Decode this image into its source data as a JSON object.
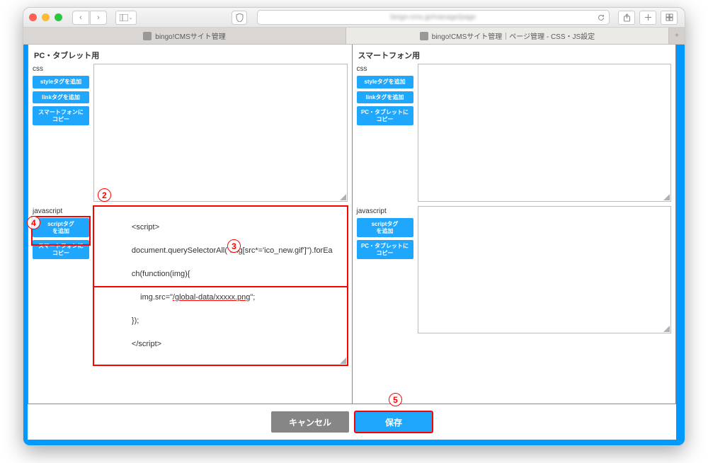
{
  "browser": {
    "url_placeholder": " ",
    "tab1": "bingo!CMSサイト管理",
    "tab2": "bingo!CMSサイト管理｜ページ管理 - CSS・JS設定"
  },
  "columns": {
    "pc": {
      "title": "PC・タブレット用",
      "css_label": "css",
      "js_label": "javascript",
      "css_buttons": [
        "styleタグを追加",
        "linkタグを追加",
        "スマートフォンに\nコピー"
      ],
      "js_buttons": [
        "scriptタグ\nを追加",
        "スマートフォンに\nコピー"
      ],
      "js_value": {
        "line1": "<script>",
        "line2a": "document.querySelectorAll(\"img[src*='ico_new.gif']\").forEa",
        "line2b": "ch(function(img){",
        "line3_pre": "    img.src=\"",
        "line3_underlined": "/global-data/xxxxx.png",
        "line3_post": "\";",
        "line4": "});",
        "line5": "</script>"
      }
    },
    "sp": {
      "title": "スマートフォン用",
      "css_label": "css",
      "js_label": "javascript",
      "css_buttons": [
        "styleタグを追加",
        "linkタグを追加",
        "PC・タブレットに\nコピー"
      ],
      "js_buttons": [
        "scriptタグ\nを追加",
        "PC・タブレットに\nコピー"
      ]
    }
  },
  "footer": {
    "cancel": "キャンセル",
    "save": "保存"
  },
  "annotations": {
    "2": "2",
    "3": "3",
    "4": "4",
    "5": "5"
  }
}
